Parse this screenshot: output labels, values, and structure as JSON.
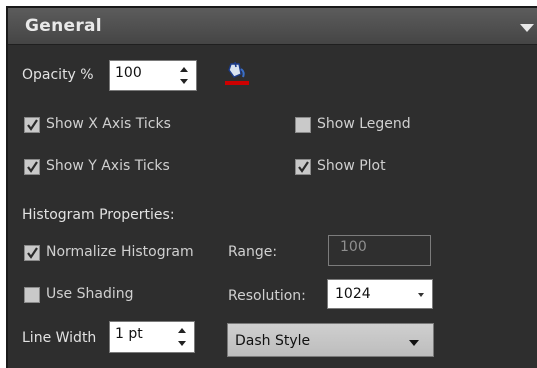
{
  "header": {
    "title": "General"
  },
  "opacity": {
    "label": "Opacity %",
    "value": "100"
  },
  "checkboxes": {
    "show_x_axis_ticks": {
      "label": "Show X Axis Ticks",
      "checked": true
    },
    "show_legend": {
      "label": "Show Legend",
      "checked": false
    },
    "show_y_axis_ticks": {
      "label": "Show Y Axis Ticks",
      "checked": true
    },
    "show_plot": {
      "label": "Show Plot",
      "checked": true
    },
    "normalize_histogram": {
      "label": "Normalize Histogram",
      "checked": true
    },
    "use_shading": {
      "label": "Use Shading",
      "checked": false
    }
  },
  "histogram": {
    "section_label": "Histogram Properties:",
    "range_label": "Range:",
    "range_value": "100",
    "resolution_label": "Resolution:",
    "resolution_value": "1024"
  },
  "line": {
    "width_label": "Line Width",
    "width_value": "1 pt",
    "dash_style": "Dash Style"
  },
  "icons": {
    "fill_color": "paint-bucket-icon",
    "fill_color_swatch": "#cc0000"
  }
}
